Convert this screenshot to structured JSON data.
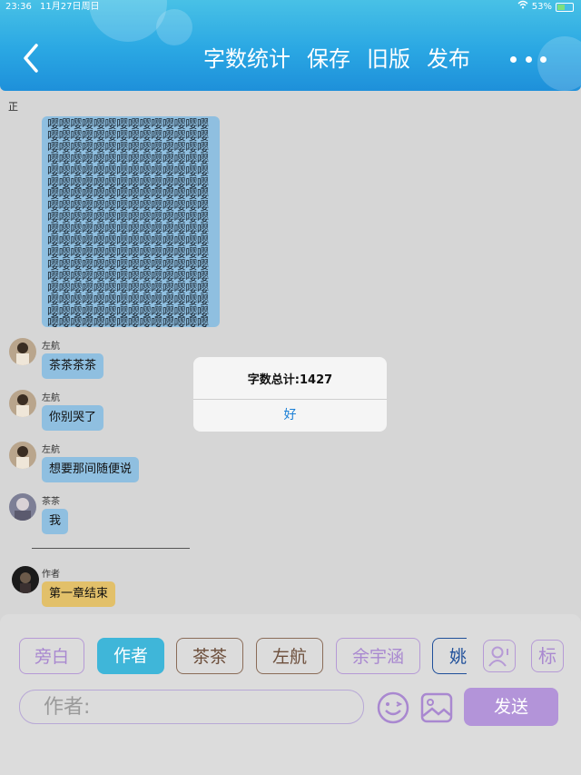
{
  "status_bar": {
    "time": "23:36",
    "date": "11月27日周日",
    "battery": "53%",
    "battery_level": 0.53
  },
  "header": {
    "nav": [
      "字数统计",
      "保存",
      "旧版",
      "发布"
    ]
  },
  "chat": {
    "narrator_label": "正",
    "narrator_text": "嘤嘤嘤嘤嘤嘤嘤嘤嘤嘤嘤嘤嘤嘤嘤嘤嘤嘤嘤嘤嘤嘤嘤嘤嘤嘤嘤嘤嘤嘤嘤嘤嘤嘤嘤嘤嘤嘤嘤嘤嘤嘤嘤嘤嘤嘤嘤嘤嘤嘤嘤嘤嘤嘤嘤嘤嘤嘤嘤嘤嘤嘤嘤嘤嘤嘤嘤嘤嘤嘤嘤嘤嘤嘤嘤嘤嘤嘤嘤嘤嘤嘤嘤嘤嘤嘤嘤嘤嘤嘤嘤嘤嘤嘤嘤嘤嘤嘤嘤嘤嘤嘤嘤嘤嘤嘤嘤嘤嘤嘤嘤嘤嘤嘤嘤嘤嘤嘤嘤嘤嘤嘤嘤嘤嘤嘤嘤嘤嘤嘤嘤嘤嘤嘤嘤嘤嘤嘤嘤嘤嘤嘤嘤嘤嘤嘤嘤嘤嘤嘤嘤嘤嘤嘤嘤嘤嘤嘤嘤嘤嘤嘤嘤嘤嘤嘤嘤嘤嘤嘤嘤嘤嘤嘤嘤嘤嘤嘤嘤嘤嘤嘤嘤嘤嘤嘤嘤嘤嘤嘤嘤嘤嘤嘤嘤嘤嘤嘤嘤嘤嘤嘤嘤嘤嘤嘤嘤嘤嘤嘤嘤嘤嘤嘤嘤嘤嘤嘤嘤嘤嘤嘤嘤嘤嘤嘤嘤嘤嘤嘤嘤嘤嘤嘤嘤嘤嘤嘤嘤嘤嘤嘤嘤嘤嘤嘤嘤嘤嘤嘤嘤嘤嘤嘤嘤嘤嘤嘤嘤",
    "messages": [
      {
        "sender": "左航",
        "text": "茶茶茶茶"
      },
      {
        "sender": "左航",
        "text": "你别哭了"
      },
      {
        "sender": "左航",
        "text": "想要那间随便说"
      },
      {
        "sender": "茶茶",
        "text": "我"
      },
      {
        "sender": "作者",
        "text": "第一章结束"
      }
    ]
  },
  "alert": {
    "message": "字数总计:1427",
    "button": "好"
  },
  "composer": {
    "roles": [
      "旁白",
      "作者",
      "茶茶",
      "左航",
      "余宇涵",
      "姚"
    ],
    "tag_button": "标",
    "input_placeholder": "作者:",
    "send": "发送"
  },
  "colors": {
    "header": "#2aa7e3",
    "bubble": "#8fbfe0",
    "author_bubble": "#e2c06a",
    "role_active": "#3fb6d9",
    "send": "#b394d9"
  }
}
